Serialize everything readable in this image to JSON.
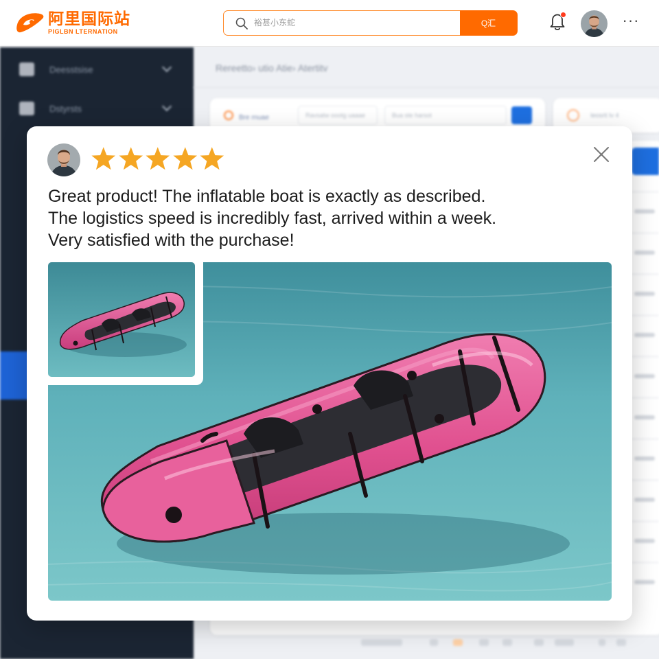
{
  "header": {
    "logo_cn": "阿里国际站",
    "logo_en": "PIGLBN LTERNATION",
    "search": {
      "placeholder": "裕甚小东蛇",
      "button_label": "Q汇"
    },
    "more_label": "···"
  },
  "sidebar": {
    "items": [
      {
        "label": "Deesstsise"
      },
      {
        "label": "Dstyrsts"
      }
    ]
  },
  "main": {
    "breadcrumb": "Rereetto›  utio Atie›  Atertitv",
    "filter_label": "Bre rnuae",
    "filter_field_1": "Ravsatw oootg uaaae",
    "filter_field_2": "Bua ste harsot",
    "side_card_label": "Ieosrit Iv 4"
  },
  "review": {
    "rating": 5,
    "max_rating": 5,
    "text_lines": [
      "Great product! The inflatable boat is exactly as described.",
      "The logistics speed is incredibly fast, arrived within a week.",
      "Very satisfied with the purchase!"
    ]
  },
  "colors": {
    "brand_orange": "#ff6a00",
    "star": "#f5a623",
    "sidebar_bg": "#1b2533",
    "primary_blue": "#1e6fe0",
    "boat_pink": "#e0508f",
    "water": "#5fb1ba"
  },
  "icons": {
    "search": "search-icon",
    "bell": "bell-icon",
    "more": "more-icon",
    "close": "close-icon",
    "star": "star-icon"
  }
}
